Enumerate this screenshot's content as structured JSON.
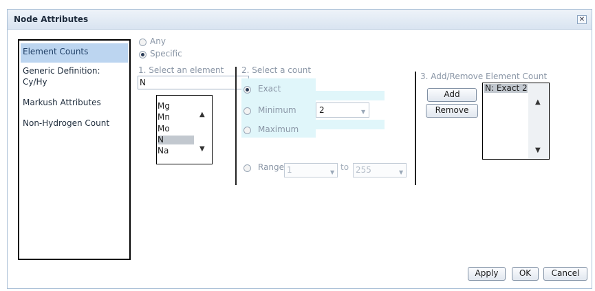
{
  "dialog": {
    "title": "Node Attributes",
    "close_glyph": "✕"
  },
  "sidebar": {
    "items": [
      {
        "label": "Element Counts",
        "selected": true
      },
      {
        "label": "Generic Definition:\nCy/Hy"
      },
      {
        "label": "Markush Attributes"
      },
      {
        "label": "Non-Hydrogen Count"
      }
    ]
  },
  "mode": {
    "any_label": "Any",
    "specific_label": "Specific",
    "selected": "Specific"
  },
  "element_select": {
    "heading": "1. Select an element",
    "input_value": "N",
    "options": [
      "Mg",
      "Mn",
      "Mo",
      "N",
      "Na"
    ],
    "selected": "N"
  },
  "count_select": {
    "heading": "2. Select a count",
    "exact_label": "Exact",
    "minimum_label": "Minimum",
    "maximum_label": "Maximum",
    "range_label": "Range",
    "to_label": "to",
    "selected": "Exact",
    "count_value": "2",
    "range_from": "1",
    "range_to": "255"
  },
  "element_count": {
    "heading": "3. Add/Remove Element Count",
    "add_label": "Add",
    "remove_label": "Remove",
    "items": [
      "N: Exact 2"
    ]
  },
  "footer": {
    "apply_label": "Apply",
    "ok_label": "OK",
    "cancel_label": "Cancel"
  },
  "colors": {
    "selection_blue": "#bcd5f0",
    "highlight_cyan": "#e0f6fa",
    "list_selection_gray": "#c2c8cf",
    "title_bar": "#d9e4f1"
  },
  "icons": {
    "close": "close-icon",
    "scroll_up": "scroll-up-arrow-icon",
    "scroll_down": "scroll-down-arrow-icon",
    "dropdown": "dropdown-arrow-icon"
  }
}
